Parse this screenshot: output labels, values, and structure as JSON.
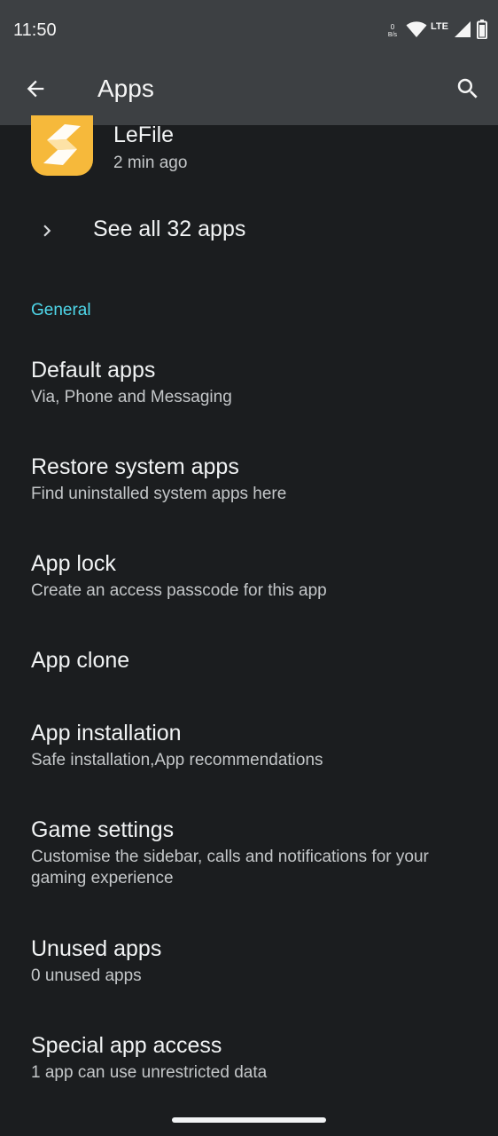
{
  "status_bar": {
    "time": "11:50",
    "net_speed_value": "0",
    "net_speed_unit": "B/s",
    "network_type": "LTE",
    "icons": [
      "wifi-icon",
      "cell-signal-icon",
      "battery-icon"
    ]
  },
  "app_bar": {
    "title": "Apps",
    "back_icon": "arrow-left-icon",
    "search_icon": "search-icon"
  },
  "recent_app": {
    "name": "LeFile",
    "time": "2 min ago",
    "icon_color": "#f6b93b"
  },
  "see_all": {
    "label": "See all 32 apps"
  },
  "section": {
    "label": "General",
    "accent": "#4fd8eb"
  },
  "items": [
    {
      "title": "Default apps",
      "subtitle": "Via, Phone and Messaging"
    },
    {
      "title": "Restore system apps",
      "subtitle": "Find uninstalled system apps here"
    },
    {
      "title": "App lock",
      "subtitle": "Create an access passcode for this app"
    },
    {
      "title": "App clone",
      "subtitle": ""
    },
    {
      "title": "App installation",
      "subtitle": "Safe installation,App recommendations"
    },
    {
      "title": "Game settings",
      "subtitle": "Customise the sidebar, calls and notifications for your gaming experience"
    },
    {
      "title": "Unused apps",
      "subtitle": "0 unused apps"
    },
    {
      "title": "Special app access",
      "subtitle": "1 app can use unrestricted data"
    }
  ]
}
